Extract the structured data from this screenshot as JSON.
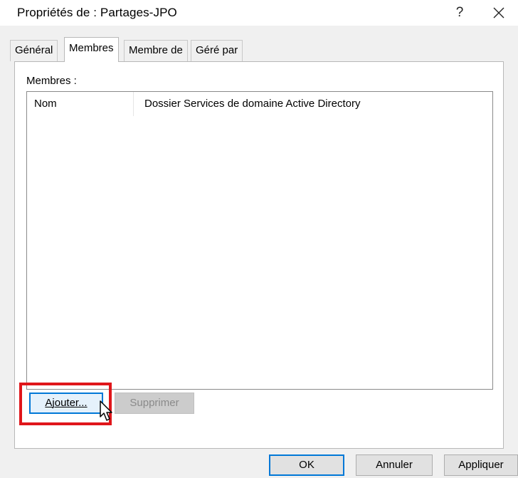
{
  "window": {
    "title": "Propriétés de : Partages-JPO",
    "help_label": "?"
  },
  "tabs": [
    {
      "label": "Général",
      "active": false
    },
    {
      "label": "Membres",
      "active": true
    },
    {
      "label": "Membre de",
      "active": false
    },
    {
      "label": "Géré par",
      "active": false
    }
  ],
  "members": {
    "label": "Membres :",
    "columns": [
      "Nom",
      "Dossier Services de domaine Active Directory"
    ],
    "rows": []
  },
  "actions": {
    "add_label": "Ajouter...",
    "remove_label": "Supprimer",
    "remove_enabled": false
  },
  "footer": {
    "ok_label": "OK",
    "cancel_label": "Annuler",
    "apply_label": "Appliquer"
  },
  "colors": {
    "highlight": "#e0161b",
    "focus_border": "#0078d7"
  },
  "icons": {
    "close": "close-icon",
    "cursor": "mouse-pointer-icon"
  }
}
